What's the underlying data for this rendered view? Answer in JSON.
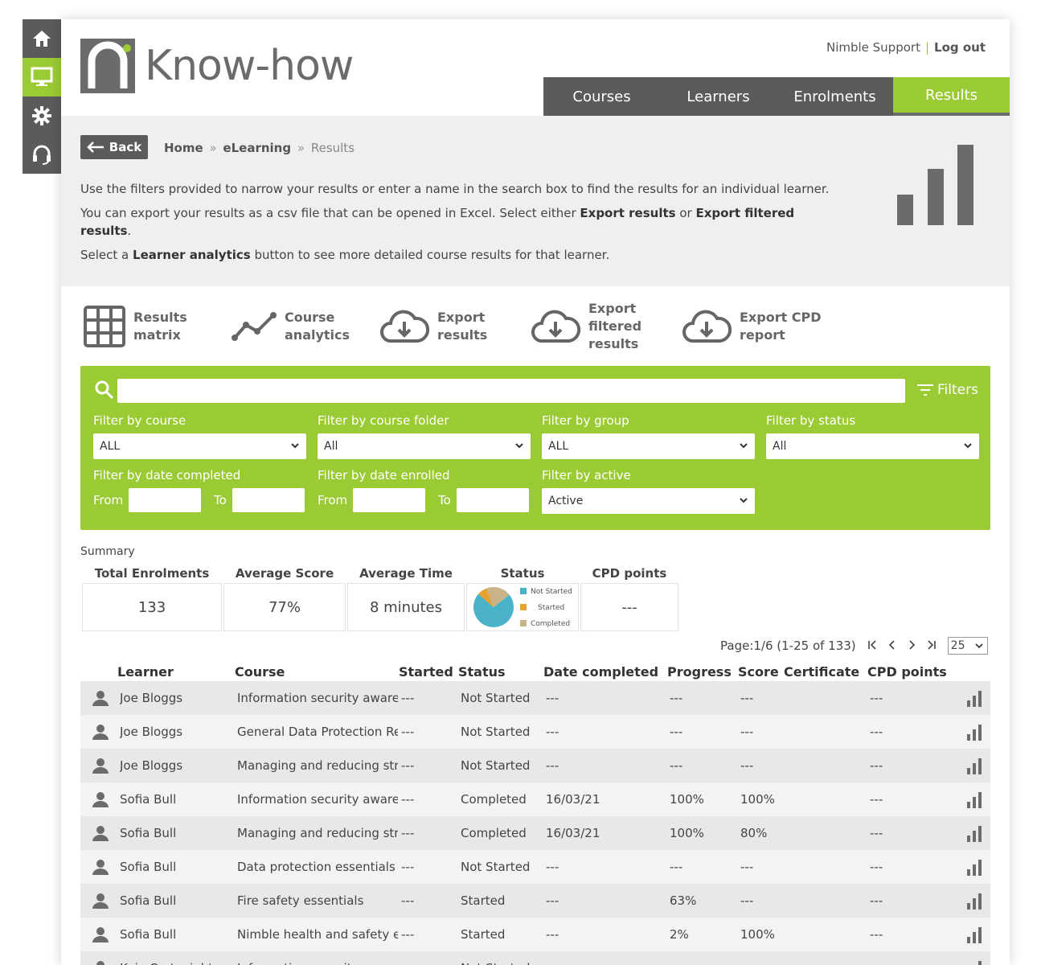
{
  "dock": {
    "items": [
      {
        "icon": "home-icon",
        "active": false
      },
      {
        "icon": "monitor-icon",
        "active": true
      },
      {
        "icon": "gear-icon",
        "active": false
      },
      {
        "icon": "headset-icon",
        "active": false
      }
    ]
  },
  "brand": {
    "name": "Know-how",
    "accent": "#9bcb34",
    "dark": "#5b5b5b"
  },
  "top_links": {
    "support": "Nimble Support",
    "separator": "|",
    "logout": "Log out"
  },
  "nav": {
    "tabs": [
      "Courses",
      "Learners",
      "Enrolments",
      "Results"
    ],
    "active": "Results"
  },
  "back_label": "Back",
  "breadcrumb": {
    "home": "Home",
    "section": "eLearning",
    "current": "Results",
    "sep": "»"
  },
  "intro": {
    "p1": "Use the filters provided to narrow your results or enter a name in the search box to find the results for an individual learner.",
    "p2_pre": "You can export your results as a csv file that can be opened in Excel. Select either ",
    "p2_b1": "Export results",
    "p2_mid": " or ",
    "p2_b2": "Export filtered results",
    "p2_post": ".",
    "p3_pre": "Select a ",
    "p3_b": "Learner analytics",
    "p3_post": " button to see more detailed course results for that learner."
  },
  "tools": {
    "matrix": [
      "Results",
      "matrix"
    ],
    "analytics": [
      "Course",
      "analytics"
    ],
    "export": [
      "Export",
      "results"
    ],
    "export_filtered": [
      "Export",
      "filtered",
      "results"
    ],
    "export_cpd": [
      "Export CPD",
      "report"
    ]
  },
  "filters": {
    "toggle_label": "Filters",
    "search_value": "",
    "course": {
      "label": "Filter by course",
      "value": "ALL"
    },
    "folder": {
      "label": "Filter by course folder",
      "value": "All"
    },
    "group": {
      "label": "Filter by group",
      "value": "ALL"
    },
    "status": {
      "label": "Filter by status",
      "value": "All"
    },
    "date_completed": {
      "label": "Filter by date completed",
      "from": "From",
      "to": "To"
    },
    "date_enrolled": {
      "label": "Filter by date enrolled",
      "from": "From",
      "to": "To"
    },
    "active": {
      "label": "Filter by active",
      "value": "Active"
    }
  },
  "summary": {
    "title": "Summary",
    "headers": {
      "total": "Total Enrolments",
      "score": "Average Score",
      "time": "Average Time",
      "status": "Status",
      "cpd": "CPD points"
    },
    "total": "133",
    "score": "77%",
    "time": "8 minutes",
    "cpd": "---",
    "status_legend": [
      {
        "label": "Not Started",
        "color": "#4bb3c8",
        "fraction": 0.72
      },
      {
        "label": "Started",
        "color": "#e8a030",
        "fraction": 0.08
      },
      {
        "label": "Completed",
        "color": "#c9b48a",
        "fraction": 0.2
      }
    ]
  },
  "pager": {
    "text": "Page:1/6 (1-25 of 133)",
    "page_size": "25"
  },
  "table": {
    "headers": [
      "Learner",
      "Course",
      "Started",
      "Status",
      "Date completed",
      "Progress",
      "Score",
      "Certificate",
      "CPD points"
    ],
    "rows": [
      {
        "learner": "Joe Bloggs",
        "course": "Information security awareness",
        "started": "---",
        "status": "Not Started",
        "date": "---",
        "progress": "---",
        "score": "---",
        "certificate": "",
        "cpd": "---"
      },
      {
        "learner": "Joe Bloggs",
        "course": "General Data Protection Regulation",
        "started": "---",
        "status": "Not Started",
        "date": "---",
        "progress": "---",
        "score": "---",
        "certificate": "",
        "cpd": "---"
      },
      {
        "learner": "Joe Bloggs",
        "course": "Managing and reducing stress",
        "started": "---",
        "status": "Not Started",
        "date": "---",
        "progress": "---",
        "score": "---",
        "certificate": "",
        "cpd": "---"
      },
      {
        "learner": "Sofia Bull",
        "course": "Information security awareness",
        "started": "---",
        "status": "Completed",
        "date": "16/03/21",
        "progress": "100%",
        "score": "100%",
        "certificate": "",
        "cpd": "---"
      },
      {
        "learner": "Sofia Bull",
        "course": "Managing and reducing stress",
        "started": "---",
        "status": "Completed",
        "date": "16/03/21",
        "progress": "100%",
        "score": "80%",
        "certificate": "",
        "cpd": "---"
      },
      {
        "learner": "Sofia Bull",
        "course": "Data protection essentials",
        "started": "---",
        "status": "Not Started",
        "date": "---",
        "progress": "---",
        "score": "---",
        "certificate": "",
        "cpd": "---"
      },
      {
        "learner": "Sofia Bull",
        "course": "Fire safety essentials",
        "started": "---",
        "status": "Started",
        "date": "---",
        "progress": "63%",
        "score": "---",
        "certificate": "",
        "cpd": "---"
      },
      {
        "learner": "Sofia Bull",
        "course": "Nimble health and safety essentials",
        "started": "---",
        "status": "Started",
        "date": "---",
        "progress": "2%",
        "score": "100%",
        "certificate": "",
        "cpd": "---"
      },
      {
        "learner": "Kaia Cartwright",
        "course": "Information security awareness",
        "started": "---",
        "status": "Not Started",
        "date": "",
        "progress": "",
        "score": "",
        "certificate": "",
        "cpd": ""
      }
    ]
  }
}
